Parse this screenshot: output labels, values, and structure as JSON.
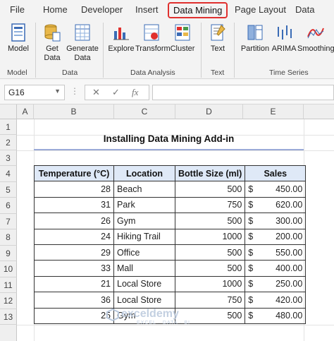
{
  "tabs": [
    {
      "label": "File"
    },
    {
      "label": "Home"
    },
    {
      "label": "Developer"
    },
    {
      "label": "Insert"
    },
    {
      "label": "Data Mining"
    },
    {
      "label": "Page Layout"
    },
    {
      "label": "Data"
    }
  ],
  "ribbon": {
    "model_label": "Model",
    "get_data": "Get\nData",
    "generate_data": "Generate\nData",
    "explore": "Explore",
    "transform": "Transform",
    "cluster": "Cluster",
    "text": "Text",
    "partition": "Partition",
    "arima": "ARIMA",
    "smoothing": "Smoothing",
    "groups": {
      "model": "Model",
      "data": "Data",
      "analysis": "Data Analysis",
      "text": "Text",
      "timeseries": "Time Series"
    }
  },
  "formula_bar": {
    "name_box": "G16",
    "cancel": "✕",
    "enter": "✓",
    "fx": "fx",
    "formula": ""
  },
  "columns": [
    "A",
    "B",
    "C",
    "D",
    "E"
  ],
  "rows": [
    "1",
    "2",
    "3",
    "4",
    "5",
    "6",
    "7",
    "8",
    "9",
    "10",
    "11",
    "12",
    "13"
  ],
  "sheet_title": "Installing Data Mining Add-in",
  "table": {
    "headers": [
      "Temperature (°C)",
      "Location",
      "Bottle Size (ml)",
      "Sales"
    ],
    "rows": [
      {
        "temp": "28",
        "loc": "Beach",
        "size": "500",
        "cur": "$",
        "sales": "450.00"
      },
      {
        "temp": "31",
        "loc": "Park",
        "size": "750",
        "cur": "$",
        "sales": "620.00"
      },
      {
        "temp": "26",
        "loc": "Gym",
        "size": "500",
        "cur": "$",
        "sales": "300.00"
      },
      {
        "temp": "24",
        "loc": "Hiking Trail",
        "size": "1000",
        "cur": "$",
        "sales": "200.00"
      },
      {
        "temp": "29",
        "loc": "Office",
        "size": "500",
        "cur": "$",
        "sales": "550.00"
      },
      {
        "temp": "33",
        "loc": "Mall",
        "size": "500",
        "cur": "$",
        "sales": "400.00"
      },
      {
        "temp": "21",
        "loc": "Local Store",
        "size": "1000",
        "cur": "$",
        "sales": "250.00"
      },
      {
        "temp": "36",
        "loc": "Local Store",
        "size": "750",
        "cur": "$",
        "sales": "420.00"
      },
      {
        "temp": "25",
        "loc": "Gym",
        "size": "500",
        "cur": "$",
        "sales": "480.00"
      }
    ]
  },
  "watermark": {
    "brand": "exceldemy",
    "tagline": "EXCEL · DATA · BI"
  },
  "colors": {
    "active_tab_outline": "#e0302e",
    "header_fill": "#dfe9f7",
    "title_underline": "#9aaad8"
  }
}
